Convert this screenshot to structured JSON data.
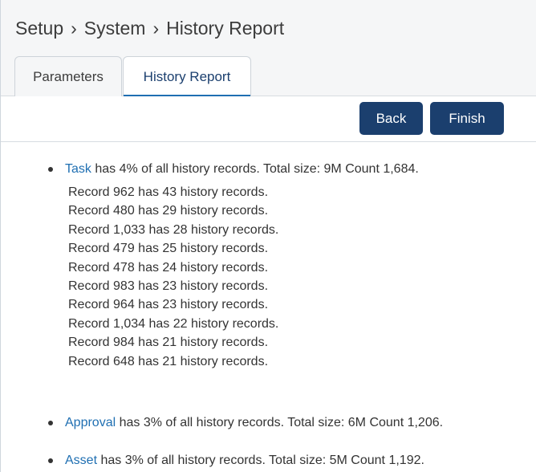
{
  "breadcrumb": [
    "Setup",
    "System",
    "History Report"
  ],
  "breadcrumb_separator": "›",
  "tabs": [
    {
      "label": "Parameters",
      "active": false
    },
    {
      "label": "History Report",
      "active": true
    }
  ],
  "toolbar": {
    "back_label": "Back",
    "finish_label": "Finish"
  },
  "colors": {
    "accent": "#1b3f6e",
    "link": "#1f6fb2",
    "header_bg": "#f5f6f7"
  },
  "entries": [
    {
      "name": "Task",
      "summary": "has 4% of all history records. Total size: 9M Count 1,684.",
      "records": [
        "Record 962 has 43 history records.",
        "Record 480 has 29 history records.",
        "Record 1,033 has 28 history records.",
        "Record 479 has 25 history records.",
        "Record 478 has 24 history records.",
        "Record 983 has 23 history records.",
        "Record 964 has 23 history records.",
        "Record 1,034 has 22 history records.",
        "Record 984 has 21 history records.",
        "Record 648 has 21 history records."
      ]
    },
    {
      "name": "Approval",
      "summary": "has 3% of all history records. Total size: 6M Count 1,206.",
      "records": []
    },
    {
      "name": "Asset",
      "summary": "has 3% of all history records. Total size: 5M Count 1,192.",
      "records": []
    }
  ]
}
